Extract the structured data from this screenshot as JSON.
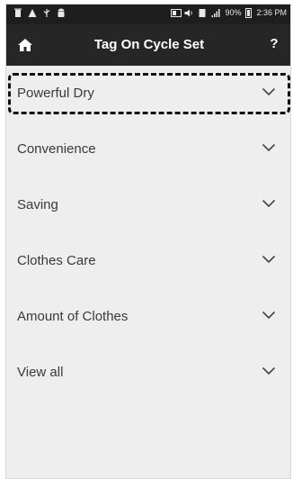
{
  "status_bar": {
    "battery_text": "90%",
    "time": "2:36 PM",
    "icons": [
      "trash-icon",
      "warning-icon",
      "usb-icon",
      "android-icon",
      "screen-icon",
      "volume-icon",
      "sim-icon",
      "signal-icon",
      "battery-icon"
    ]
  },
  "header": {
    "title": "Tag On Cycle Set",
    "help_label": "?"
  },
  "menu": {
    "items": [
      {
        "label": "Powerful Dry",
        "highlighted": true
      },
      {
        "label": "Convenience"
      },
      {
        "label": "Saving"
      },
      {
        "label": "Clothes Care"
      },
      {
        "label": "Amount of Clothes"
      },
      {
        "label": "View all"
      }
    ]
  },
  "colors": {
    "status_bar_bg": "#1e1e1e",
    "title_bar_bg": "#262626",
    "list_bg": "#eeeeee",
    "label_text": "#3a3a3a",
    "highlight_border": "#111111"
  }
}
